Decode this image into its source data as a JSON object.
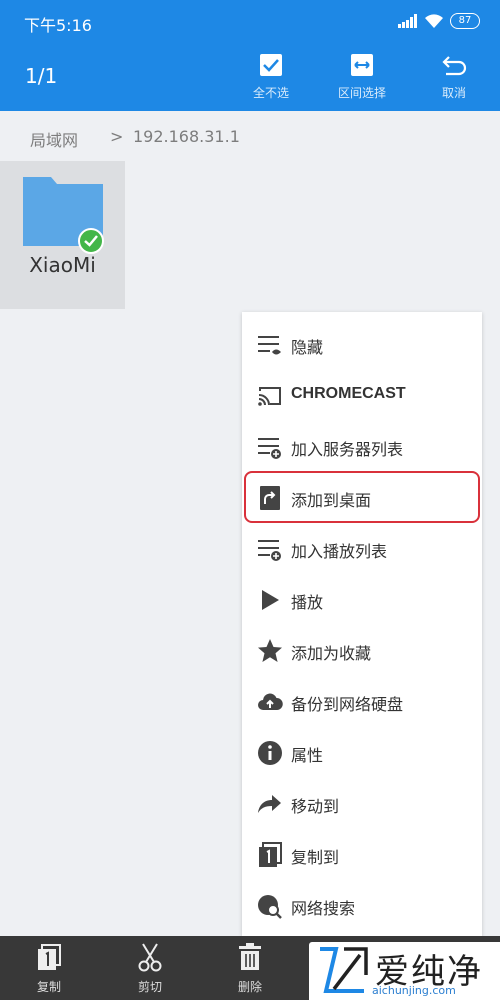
{
  "status_bar": {
    "time": "下午5:16",
    "battery": "87"
  },
  "action_bar": {
    "selection_count": "1/1",
    "buttons": [
      {
        "label": "全不选",
        "icon": "checkbox-icon"
      },
      {
        "label": "区间选择",
        "icon": "range-select-icon"
      },
      {
        "label": "取消",
        "icon": "undo-icon"
      }
    ]
  },
  "breadcrumb": {
    "items": [
      "局域网",
      "192.168.31.1"
    ],
    "separator": ">"
  },
  "folder": {
    "name": "XiaoMi",
    "selected": true
  },
  "context_menu": {
    "items": [
      {
        "label": "隐藏",
        "icon": "hide-list-icon"
      },
      {
        "label": "CHROMECAST",
        "icon": "cast-icon"
      },
      {
        "label": "加入服务器列表",
        "icon": "add-list-icon"
      },
      {
        "label": "添加到桌面",
        "icon": "shortcut-icon",
        "highlighted": true
      },
      {
        "label": "加入播放列表",
        "icon": "add-playlist-icon"
      },
      {
        "label": "播放",
        "icon": "play-icon"
      },
      {
        "label": "添加为收藏",
        "icon": "star-icon"
      },
      {
        "label": "备份到网络硬盘",
        "icon": "cloud-upload-icon"
      },
      {
        "label": "属性",
        "icon": "info-icon"
      },
      {
        "label": "移动到",
        "icon": "share-arrow-icon"
      },
      {
        "label": "复制到",
        "icon": "copy-to-icon"
      },
      {
        "label": "网络搜索",
        "icon": "web-search-icon"
      }
    ]
  },
  "bottom_bar": {
    "buttons": [
      {
        "label": "复制",
        "icon": "copy-icon"
      },
      {
        "label": "剪切",
        "icon": "scissors-icon"
      },
      {
        "label": "删除",
        "icon": "trash-icon"
      }
    ]
  },
  "watermark": {
    "text": "爱纯净",
    "url": "aichunjing.com"
  },
  "colors": {
    "primary": "#1e88e5",
    "highlight_border": "#d9313b",
    "check_green": "#43b649",
    "bottom_bar": "#383838"
  }
}
